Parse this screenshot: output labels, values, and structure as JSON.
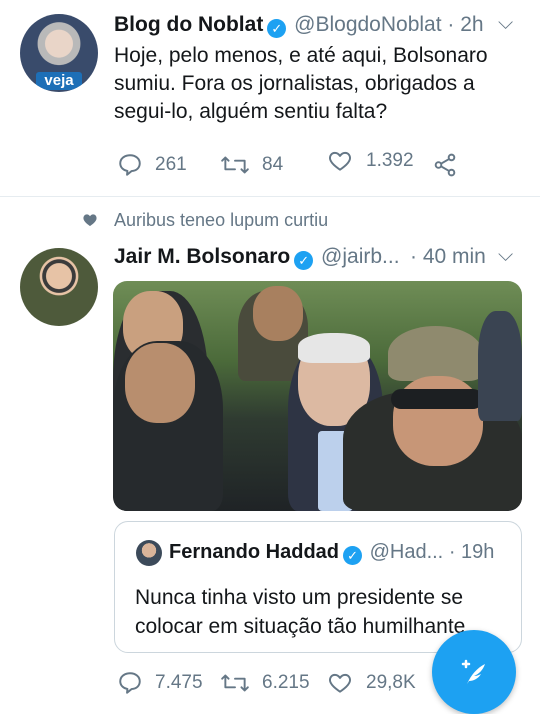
{
  "tweet1": {
    "display_name": "Blog do Noblat",
    "handle": "@BlogdoNoblat",
    "time": "· 2h",
    "avatar_badge": "veja",
    "text_lines": [
      "Hoje, pelo menos, e até aqui, Bolsonaro",
      "sumiu. Fora os jornalistas, obrigados a",
      "segui-lo, alguém sentiu falta?"
    ],
    "replies": "261",
    "retweets": "84",
    "likes": "1.392"
  },
  "tweet2": {
    "social_context": "Auribus teneo lupum curtiu",
    "display_name": "Jair M. Bolsonaro",
    "handle": "@jairb...",
    "time": "· 40 min",
    "quoted": {
      "display_name": "Fernando Haddad",
      "handle": "@Had...",
      "time": "· 19h",
      "text_lines": [
        "Nunca tinha visto um presidente se",
        "colocar em situação tão humilhante."
      ]
    },
    "replies": "7.475",
    "retweets": "6.215",
    "likes": "29,8K"
  },
  "colors": {
    "accent": "#1da1f2",
    "muted": "#657786",
    "text": "#14171a",
    "border": "#ccd6dd"
  },
  "icons": [
    "verified-badge-icon",
    "chevron-down-icon",
    "reply-icon",
    "retweet-icon",
    "like-icon",
    "share-icon",
    "heart-small-icon",
    "compose-tweet-icon"
  ]
}
